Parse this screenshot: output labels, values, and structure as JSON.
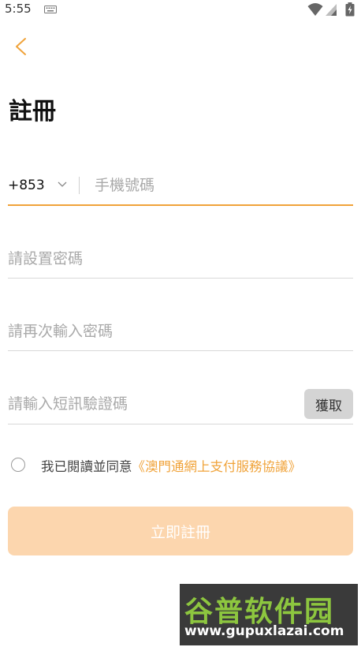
{
  "status_bar": {
    "time": "5:55"
  },
  "header": {
    "back_icon": "chevron-left-icon",
    "title": "註冊"
  },
  "form": {
    "country_code": "+853",
    "phone_placeholder": "手機號碼",
    "password_placeholder": "請設置密碼",
    "confirm_password_placeholder": "請再次輸入密碼",
    "sms_code_placeholder": "請輸入短訊驗證碼",
    "get_code_label": "獲取"
  },
  "agreement": {
    "text": "我已閱讀並同意",
    "link": "《澳門通網上支付服務協議》"
  },
  "register_button": "立即註冊",
  "watermark": {
    "cn": "谷普软件园",
    "url": "www.gupuxlazai.com"
  },
  "colors": {
    "accent": "#f0a33a",
    "button_disabled": "#fcd6ae",
    "get_code_bg": "#d4d4d4"
  }
}
